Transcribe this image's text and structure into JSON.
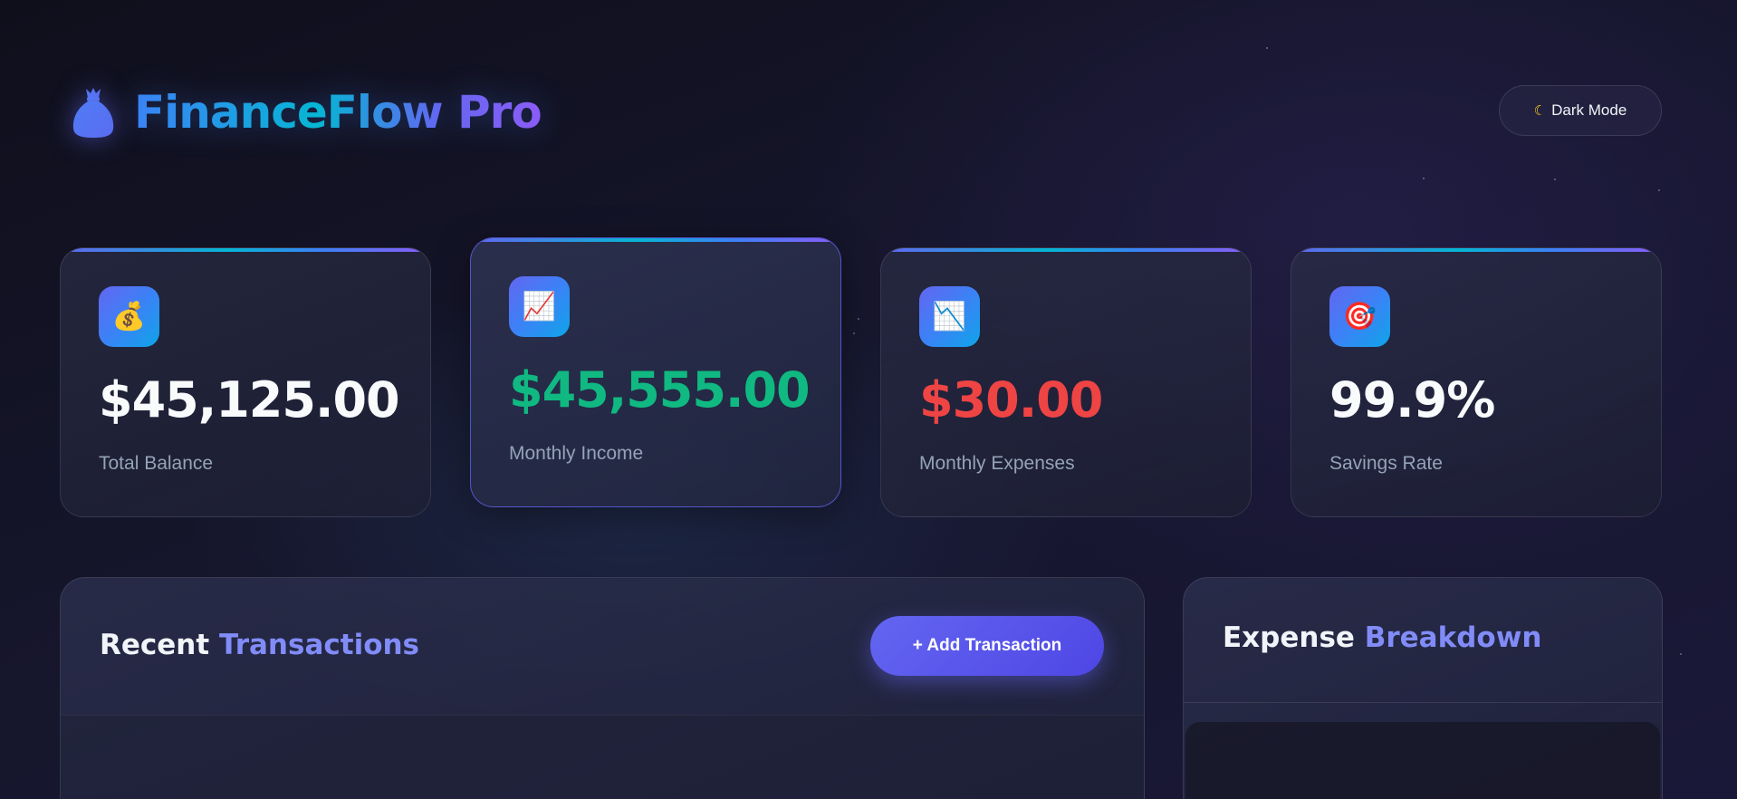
{
  "app": {
    "title": "FinanceFlow Pro",
    "brand_icon": "money-bag-icon",
    "theme_toggle": {
      "icon": "moon-icon",
      "label": "Dark Mode"
    }
  },
  "stats": [
    {
      "icon": "money-bag-icon",
      "glyph": "💰",
      "value": "$45,125.00",
      "label": "Total Balance",
      "value_color": "#f8fafc"
    },
    {
      "icon": "chart-up-icon",
      "glyph": "📈",
      "value": "$45,555.00",
      "label": "Monthly Income",
      "value_color": "#10b981"
    },
    {
      "icon": "chart-down-icon",
      "glyph": "📉",
      "value": "$30.00",
      "label": "Monthly Expenses",
      "value_color": "#ef4444"
    },
    {
      "icon": "target-icon",
      "glyph": "🎯",
      "value": "99.9%",
      "label": "Savings Rate",
      "value_color": "#f8fafc"
    }
  ],
  "transactions": {
    "title_main": "Recent",
    "title_accent": "Transactions",
    "add_button": "+ Add Transaction"
  },
  "breakdown": {
    "title_main": "Expense",
    "title_accent": "Breakdown"
  },
  "colors": {
    "accent": "#818cf8",
    "primary": "#6366f1",
    "income": "#10b981",
    "expense": "#ef4444",
    "muted_text": "#94a3b8"
  }
}
